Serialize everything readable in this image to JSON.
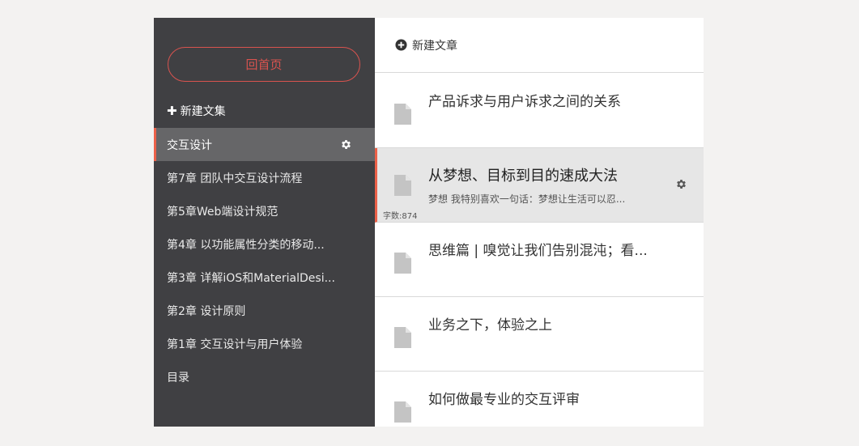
{
  "sidebar": {
    "home_label": "回首页",
    "new_collection_label": "新建文集",
    "items": [
      {
        "label": "交互设计"
      },
      {
        "label": "第7章 团队中交互设计流程"
      },
      {
        "label": "第5章Web端设计规范"
      },
      {
        "label": "第4章 以功能属性分类的移动..."
      },
      {
        "label": "第3章 详解iOS和MaterialDesi..."
      },
      {
        "label": "第2章 设计原则"
      },
      {
        "label": "第1章 交互设计与用户体验"
      },
      {
        "label": "目录"
      }
    ],
    "active_index": 0
  },
  "main": {
    "new_article_label": "新建文章",
    "articles": [
      {
        "title": "产品诉求与用户诉求之间的关系"
      },
      {
        "title": "从梦想、目标到目的速成大法",
        "summary": "梦想 我特别喜欢一句话：梦想让生活可以忍...",
        "word_count": "字数:874"
      },
      {
        "title": "思维篇 | 嗅觉让我们告别混沌；看..."
      },
      {
        "title": "业务之下，体验之上"
      },
      {
        "title": "如何做最专业的交互评审"
      }
    ],
    "active_index": 1
  },
  "colors": {
    "sidebar_bg": "#404043",
    "sidebar_active_bg": "#666668",
    "accent": "#ec6149",
    "home_button": "#d9534f",
    "active_article_bg": "#e6e6e6"
  },
  "icons": {
    "plus": "plus-icon",
    "gear": "gear-icon",
    "plus_circle": "plus-circle-icon",
    "document": "document-icon"
  }
}
